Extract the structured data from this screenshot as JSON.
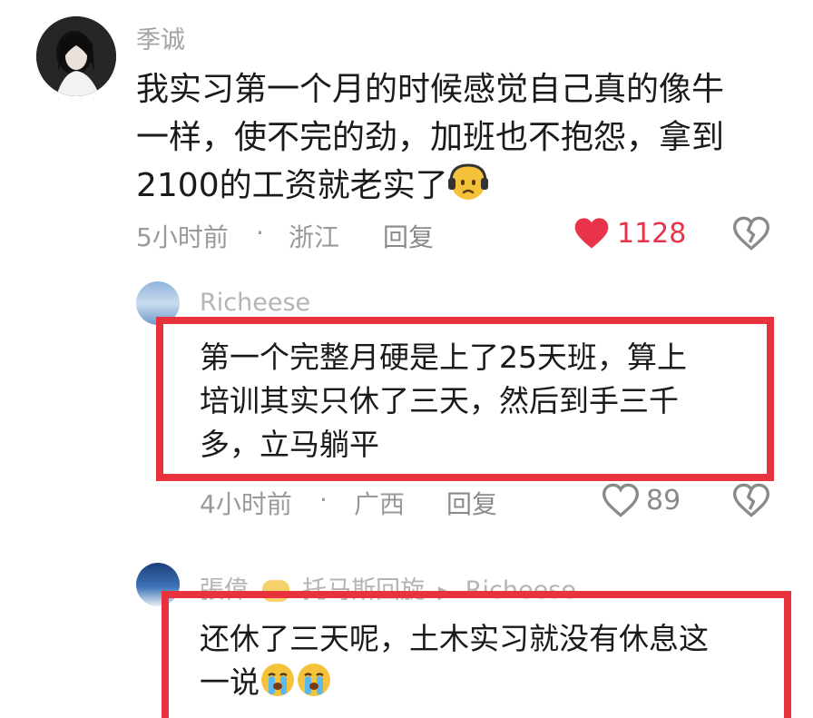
{
  "comments": [
    {
      "author": "季诚",
      "lines": [
        "我实习第一个月的时候感觉自己真的像牛",
        "一样，使不完的劲，加班也不抱怨，拿到",
        "2100的工资就老实了"
      ],
      "time": "5小时前",
      "separator": "·",
      "location": "浙江",
      "reply_label": "回复",
      "likes": "1128",
      "liked": true
    },
    {
      "author": "Richeese",
      "lines": [
        "第一个完整月硬是上了25天班，算上",
        "培训其实只休了三天，然后到手三千",
        "多，立马躺平"
      ],
      "time": "4小时前",
      "separator": "·",
      "location": "广西",
      "reply_label": "回复",
      "likes": "89",
      "liked": false
    },
    {
      "author": "張偉",
      "reply_to_label": "托马斯回旋",
      "reply_target": "Richeese",
      "lines": [
        "还休了三天呢，土木实习就没有休息这",
        "一说"
      ]
    }
  ],
  "colors": {
    "like_red": "#e8334a",
    "highlight_red": "#e8333f",
    "meta_gray": "#9a9a9a"
  }
}
